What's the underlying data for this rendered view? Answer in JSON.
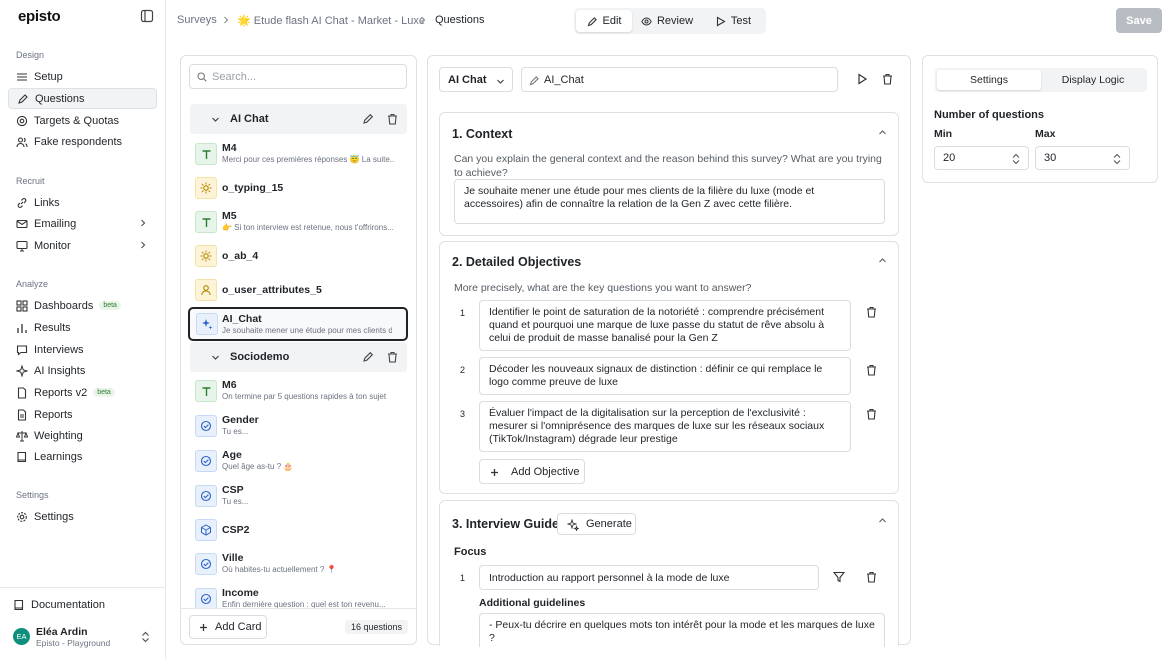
{
  "sidebar": {
    "logo": "episto",
    "sections": {
      "design": "Design",
      "recruit": "Recruit",
      "analyze": "Analyze",
      "settings": "Settings"
    },
    "design_items": [
      "Setup",
      "Questions",
      "Targets & Quotas",
      "Fake respondents"
    ],
    "recruit_items": [
      "Links",
      "Emailing",
      "Monitor"
    ],
    "analyze_items": [
      "Dashboards",
      "Results",
      "Interviews",
      "AI Insights",
      "Reports v2",
      "Reports",
      "Weighting",
      "Learnings"
    ],
    "beta_label": "beta",
    "settings_items": [
      "Settings"
    ],
    "documentation": "Documentation",
    "user": {
      "initials": "EA",
      "name": "Eléa Ardin",
      "org": "Episto - Playground"
    }
  },
  "breadcrumb": {
    "root": "Surveys",
    "survey": "🌟 Etude flash AI Chat - Market - Luxe",
    "page": "Questions"
  },
  "modes": {
    "edit": "Edit",
    "review": "Review",
    "test": "Test"
  },
  "save_label": "Save",
  "cards_panel": {
    "search_placeholder": "Search...",
    "groups": [
      {
        "name": "AI Chat"
      },
      {
        "name": "Sociodemo"
      }
    ],
    "cards_group1": [
      {
        "title": "M4",
        "sub": "Merci pour ces premières réponses 😇 La suite..."
      },
      {
        "title": "o_typing_15",
        "sub": ""
      },
      {
        "title": "M5",
        "sub": "👉 Si ton interview est retenue, nous t'offrirons..."
      },
      {
        "title": "o_ab_4",
        "sub": ""
      },
      {
        "title": "o_user_attributes_5",
        "sub": ""
      },
      {
        "title": "AI_Chat",
        "sub": "Je souhaite mener une étude pour mes clients de la filière"
      }
    ],
    "cards_group2": [
      {
        "title": "M6",
        "sub": "On termine par 5 questions rapides à ton sujet"
      },
      {
        "title": "Gender",
        "sub": "Tu es..."
      },
      {
        "title": "Age",
        "sub": "Quel âge as-tu ? 🎂"
      },
      {
        "title": "CSP",
        "sub": "Tu es..."
      },
      {
        "title": "CSP2",
        "sub": ""
      },
      {
        "title": "Ville",
        "sub": "Où habites-tu actuellement ? 📍"
      },
      {
        "title": "Income",
        "sub": "Enfin dernière question : quel est ton revenu..."
      }
    ],
    "add_card": "Add Card",
    "count": "16 questions"
  },
  "editor": {
    "type": "AI Chat",
    "name": "AI_Chat",
    "context": {
      "title": "1. Context",
      "prompt": "Can you explain the general context and the reason behind this survey? What are you trying to achieve?",
      "value": "Je souhaite mener une étude pour mes clients de la filière du luxe (mode et accessoires) afin de connaître la relation de la Gen Z avec cette filière."
    },
    "objectives": {
      "title": "2. Detailed Objectives",
      "prompt": "More precisely, what are the key questions you want to answer?",
      "items": [
        "Identifier le point de saturation de la notoriété : comprendre précisément quand et pourquoi une marque de luxe passe du statut de rêve absolu à celui de produit de masse banalisé pour la Gen Z",
        "Décoder les nouveaux signaux de distinction : définir ce qui remplace le logo comme preuve de luxe",
        "Évaluer l'impact de la digitalisation sur la perception de l'exclusivité : mesurer si l'omniprésence des marques de luxe sur les réseaux sociaux (TikTok/Instagram) dégrade leur prestige"
      ],
      "add_label": "Add Objective"
    },
    "guide": {
      "title": "3. Interview Guide",
      "generate": "Generate",
      "focus_label": "Focus",
      "focus_items": [
        "Introduction au rapport personnel à la mode de luxe"
      ],
      "guidelines_label": "Additional guidelines",
      "guidelines_value": "- Peux-tu décrire en quelques mots ton intérêt pour la mode et les marques de luxe ?"
    }
  },
  "settings_panel": {
    "tabs": [
      "Settings",
      "Display Logic"
    ],
    "num_label": "Number of questions",
    "min_label": "Min",
    "max_label": "Max",
    "min_value": "20",
    "max_value": "30"
  },
  "colors": {
    "accent": "#1f2328",
    "green": "#2f7d32",
    "teal": "#0e8f7e",
    "save_disabled": "#b8bdc4"
  }
}
